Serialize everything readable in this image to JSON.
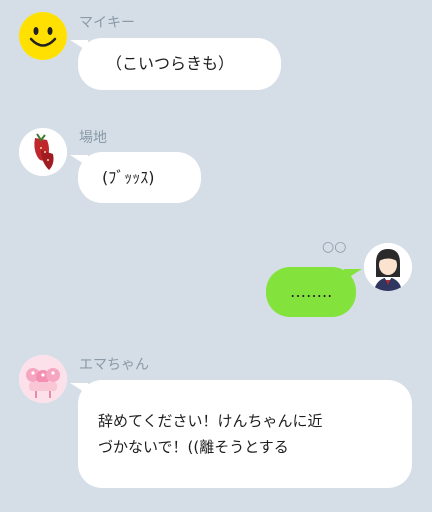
{
  "chat": {
    "messages": [
      {
        "sender": "マイキー",
        "side": "left",
        "text": "（こいつらきも）",
        "avatar_icon": "smiley-face-icon"
      },
      {
        "sender": "場地",
        "side": "left",
        "text": "(ﾌﾞｯｯｽ)",
        "avatar_icon": "strawberry-icon"
      },
      {
        "side": "right",
        "text": "……..",
        "read_status": "○○",
        "avatar_icon": "schoolgirl-icon"
      },
      {
        "sender": "エマちゃん",
        "side": "left",
        "text_line1": "辞めてください！けんちゃんに近",
        "text_line2": "づかないで！((離そうとする",
        "avatar_icon": "pink-cake-icon"
      }
    ]
  },
  "colors": {
    "background": "#d5dee6",
    "incoming_bubble": "#ffffff",
    "outgoing_bubble": "#84e23c",
    "sender_name": "#8a9aa8"
  }
}
